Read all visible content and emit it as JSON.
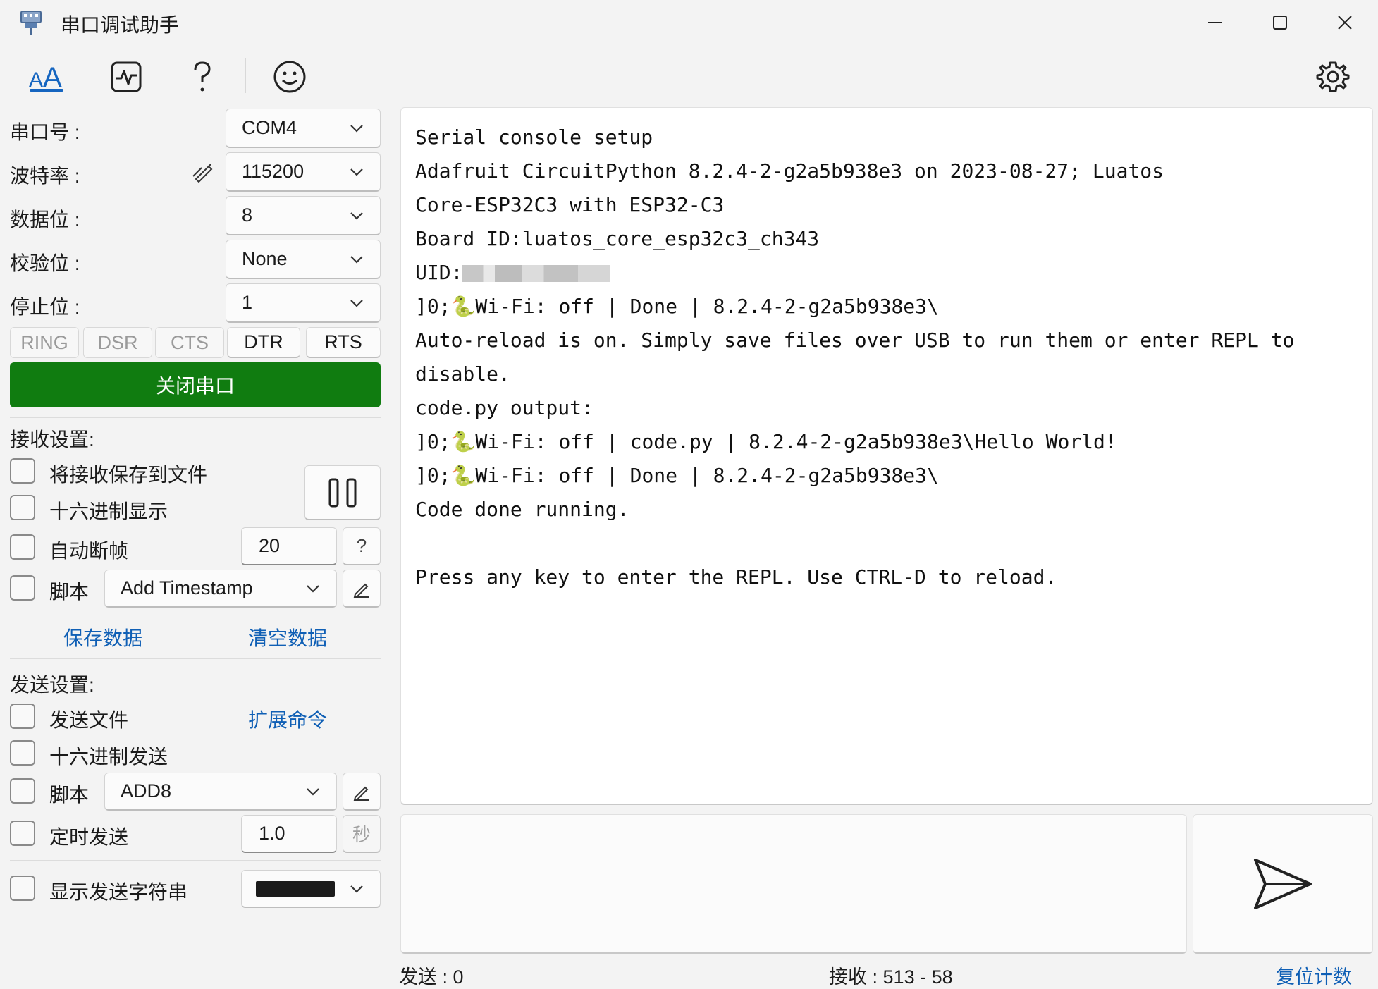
{
  "window": {
    "title": "串口调试助手"
  },
  "toolbar": {
    "items": [
      "text-icon",
      "waveform-icon",
      "help-icon",
      "smiley-icon"
    ],
    "settings_icon": "gear-icon"
  },
  "serial": {
    "port_label": "串口号 :",
    "port_value": "COM4",
    "baud_label": "波特率 :",
    "baud_value": "115200",
    "databits_label": "数据位 :",
    "databits_value": "8",
    "parity_label": "校验位 :",
    "parity_value": "None",
    "stopbits_label": "停止位 :",
    "stopbits_value": "1",
    "pins": [
      "RING",
      "DSR",
      "CTS",
      "DTR",
      "RTS"
    ],
    "toggle_button": "关闭串口",
    "toggle_color": "#107c10"
  },
  "receive": {
    "heading": "接收设置:",
    "save_to_file": "将接收保存到文件",
    "hex_display": "十六进制显示",
    "auto_frame": "自动断帧",
    "auto_frame_value": "20",
    "help_mark": "?",
    "script": "脚本",
    "script_value": "Add Timestamp",
    "save_data": "保存数据",
    "clear_data": "清空数据"
  },
  "send": {
    "heading": "发送设置:",
    "send_file": "发送文件",
    "extended_cmd": "扩展命令",
    "hex_send": "十六进制发送",
    "script": "脚本",
    "script_value": "ADD8",
    "timed_send": "定时发送",
    "timed_value": "1.0",
    "timed_unit": "秒",
    "show_sent": "显示发送字符串",
    "color_swatch": "#1b1b1b"
  },
  "console": {
    "lines": [
      "Serial console setup",
      "Adafruit CircuitPython 8.2.4-2-g2a5b938e3 on 2023-08-27; Luatos",
      "Core-ESP32C3 with ESP32-C3",
      "Board ID:luatos_core_esp32c3_ch343",
      "UID:",
      "]0;🐍Wi-Fi: off | Done | 8.2.4-2-g2a5b938e3\\",
      "Auto-reload is on. Simply save files over USB to run them or enter REPL to",
      "disable.",
      "code.py output:",
      "]0;🐍Wi-Fi: off | code.py | 8.2.4-2-g2a5b938e3\\Hello World!",
      "]0;🐍Wi-Fi: off | Done | 8.2.4-2-g2a5b938e3\\",
      "Code done running.",
      "",
      "Press any key to enter the REPL. Use CTRL-D to reload."
    ]
  },
  "status": {
    "sent_label": "发送 :",
    "sent_value": "0",
    "recv_label": "接收 :",
    "recv_value": "513 - 58",
    "reset": "复位计数"
  }
}
